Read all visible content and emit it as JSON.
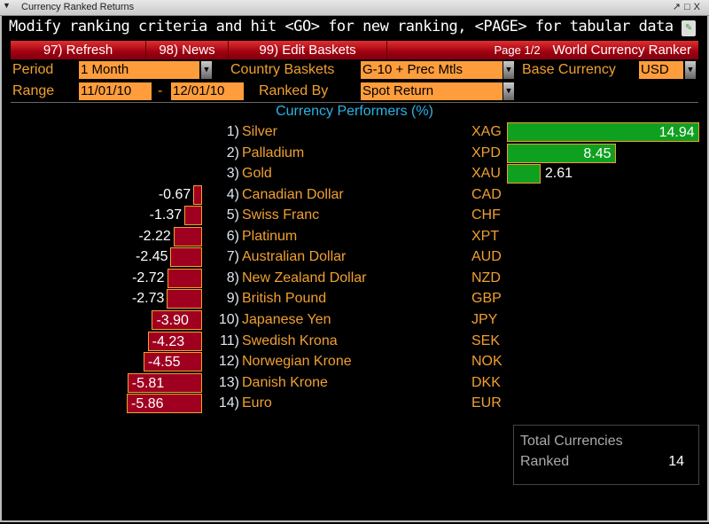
{
  "window": {
    "title": "Currency Ranked Returns"
  },
  "hint": "Modify ranking criteria and hit <GO> for new ranking, <PAGE> for tabular data",
  "menu": {
    "refresh": "97) Refresh",
    "news": "98) News",
    "edit": "99) Edit Baskets",
    "page": "Page 1/2",
    "app_title": "World Currency Ranker"
  },
  "form": {
    "period_label": "Period",
    "period": "1 Month",
    "baskets_label": "Country Baskets",
    "baskets": "G-10 + Prec Mtls",
    "base_label": "Base Currency",
    "base": "USD",
    "range_label": "Range",
    "range_from": "11/01/10",
    "range_sep": "-",
    "range_to": "12/01/10",
    "ranked_label": "Ranked By",
    "ranked": "Spot Return"
  },
  "chart_data": {
    "type": "bar",
    "title": "Currency Performers  (%)",
    "rows": [
      {
        "rank": "1)",
        "name": "Silver",
        "code": "XAG",
        "value": 14.94
      },
      {
        "rank": "2)",
        "name": "Palladium",
        "code": "XPD",
        "value": 8.45
      },
      {
        "rank": "3)",
        "name": "Gold",
        "code": "XAU",
        "value": 2.61
      },
      {
        "rank": "4)",
        "name": "Canadian Dollar",
        "code": "CAD",
        "value": -0.67
      },
      {
        "rank": "5)",
        "name": "Swiss Franc",
        "code": "CHF",
        "value": -1.37
      },
      {
        "rank": "6)",
        "name": "Platinum",
        "code": "XPT",
        "value": -2.22
      },
      {
        "rank": "7)",
        "name": "Australian Dollar",
        "code": "AUD",
        "value": -2.45
      },
      {
        "rank": "8)",
        "name": "New Zealand Dollar",
        "code": "NZD",
        "value": -2.72
      },
      {
        "rank": "9)",
        "name": "British Pound",
        "code": "GBP",
        "value": -2.73
      },
      {
        "rank": "10)",
        "name": "Japanese Yen",
        "code": "JPY",
        "value": -3.9
      },
      {
        "rank": "11)",
        "name": "Swedish Krona",
        "code": "SEK",
        "value": -4.23
      },
      {
        "rank": "12)",
        "name": "Norwegian Krone",
        "code": "NOK",
        "value": -4.55
      },
      {
        "rank": "13)",
        "name": "Danish Krone",
        "code": "DKK",
        "value": -5.81
      },
      {
        "rank": "14)",
        "name": "Euro",
        "code": "EUR",
        "value": -5.86
      }
    ]
  },
  "total": {
    "label1": "Total Currencies",
    "label2": "Ranked",
    "count": "14"
  },
  "colors": {
    "neg": "#a00020",
    "pos": "#10a020",
    "orange": "#f0a030"
  }
}
